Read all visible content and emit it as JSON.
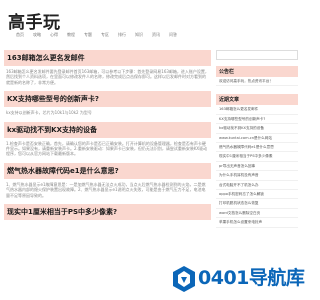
{
  "site": {
    "title": "高手玩"
  },
  "nav": {
    "items": [
      "首页",
      "攻略",
      "心得",
      "教程",
      "专题",
      "专区",
      "排行",
      "知识",
      "资讯",
      "问答"
    ]
  },
  "articles": [
    {
      "title": "163邮箱怎么更名发邮件",
      "body": "163邮箱怎么更名发邮件要先登录邮件首页163邮箱，可以参考以下步骤：首先登录网易163邮箱，进入账户设置，然后找到个人资料选项，在里面可以修改发件人的名称，修改完成后点击保存即可。这样以后发邮件时对方看到的就是新的名称了，非常方便。"
    },
    {
      "title": "KX支持哪些型号的创新声卡?",
      "body": "kx支持以创新声卡，芯片为10k1与10k2 为型号"
    },
    {
      "title": "kx驱动找不到KX支持的设备",
      "body": "1.检查声卡是否安装正确，首先，请确认您的声卡是否已正确安装。打开计算机的设备管理器，检查是否有声卡硬件显示。如果没有，请重新安装声卡。2.重新安装驱动：如果声卡已安装，但仍无法识别，请尝试重新安装KX驱动程序，您可以从官方网站下载最新版本。"
    },
    {
      "title": "燃气热水器故障代码e1是什么意思?",
      "body": "1、燃气热水器显示e1故障意思是：一是加燃气热水器无法点火成功，当点火后燃气热水器检测到的火焰，二是燃气热水器内部的熄火保护装置出现故障。2、燃气热水器显示e1说明点火失败，可能是由于燃气压力不足，电池电量不足等原因导致的。"
    },
    {
      "title": "现实中1厘米相当于PS中多少像素?",
      "body": ""
    }
  ],
  "sidebar": {
    "widgets": [
      {
        "title": "公告栏",
        "items": [
          "欢迎访问高手玩，热点资讯平台！"
        ]
      },
      {
        "title": "近期文章",
        "items": [
          "163邮箱怎么更名发邮件",
          "KX支持哪些型号的创新声卡?",
          "kx驱动找不到KX支持的设备",
          "www.kuntai.com.cn是什么网站",
          "燃气热水器故障代码e1是什么意思",
          "现实中1厘米相当于PS中多少像素",
          "pr导出无声音怎么回事",
          "为什么手机耳机没有声音",
          "台式电脑开不了机怎么办",
          "oppo手机密码忘了怎么解锁",
          "打印机脱机状态怎么恢复",
          "word文档怎么删除空白页",
          "苹果手机怎么设置来电铃声"
        ]
      }
    ]
  },
  "watermark": {
    "text": "0401导航库"
  },
  "colors": {
    "accent_bg": "#fad7cf",
    "watermark": "#0b66b8"
  }
}
